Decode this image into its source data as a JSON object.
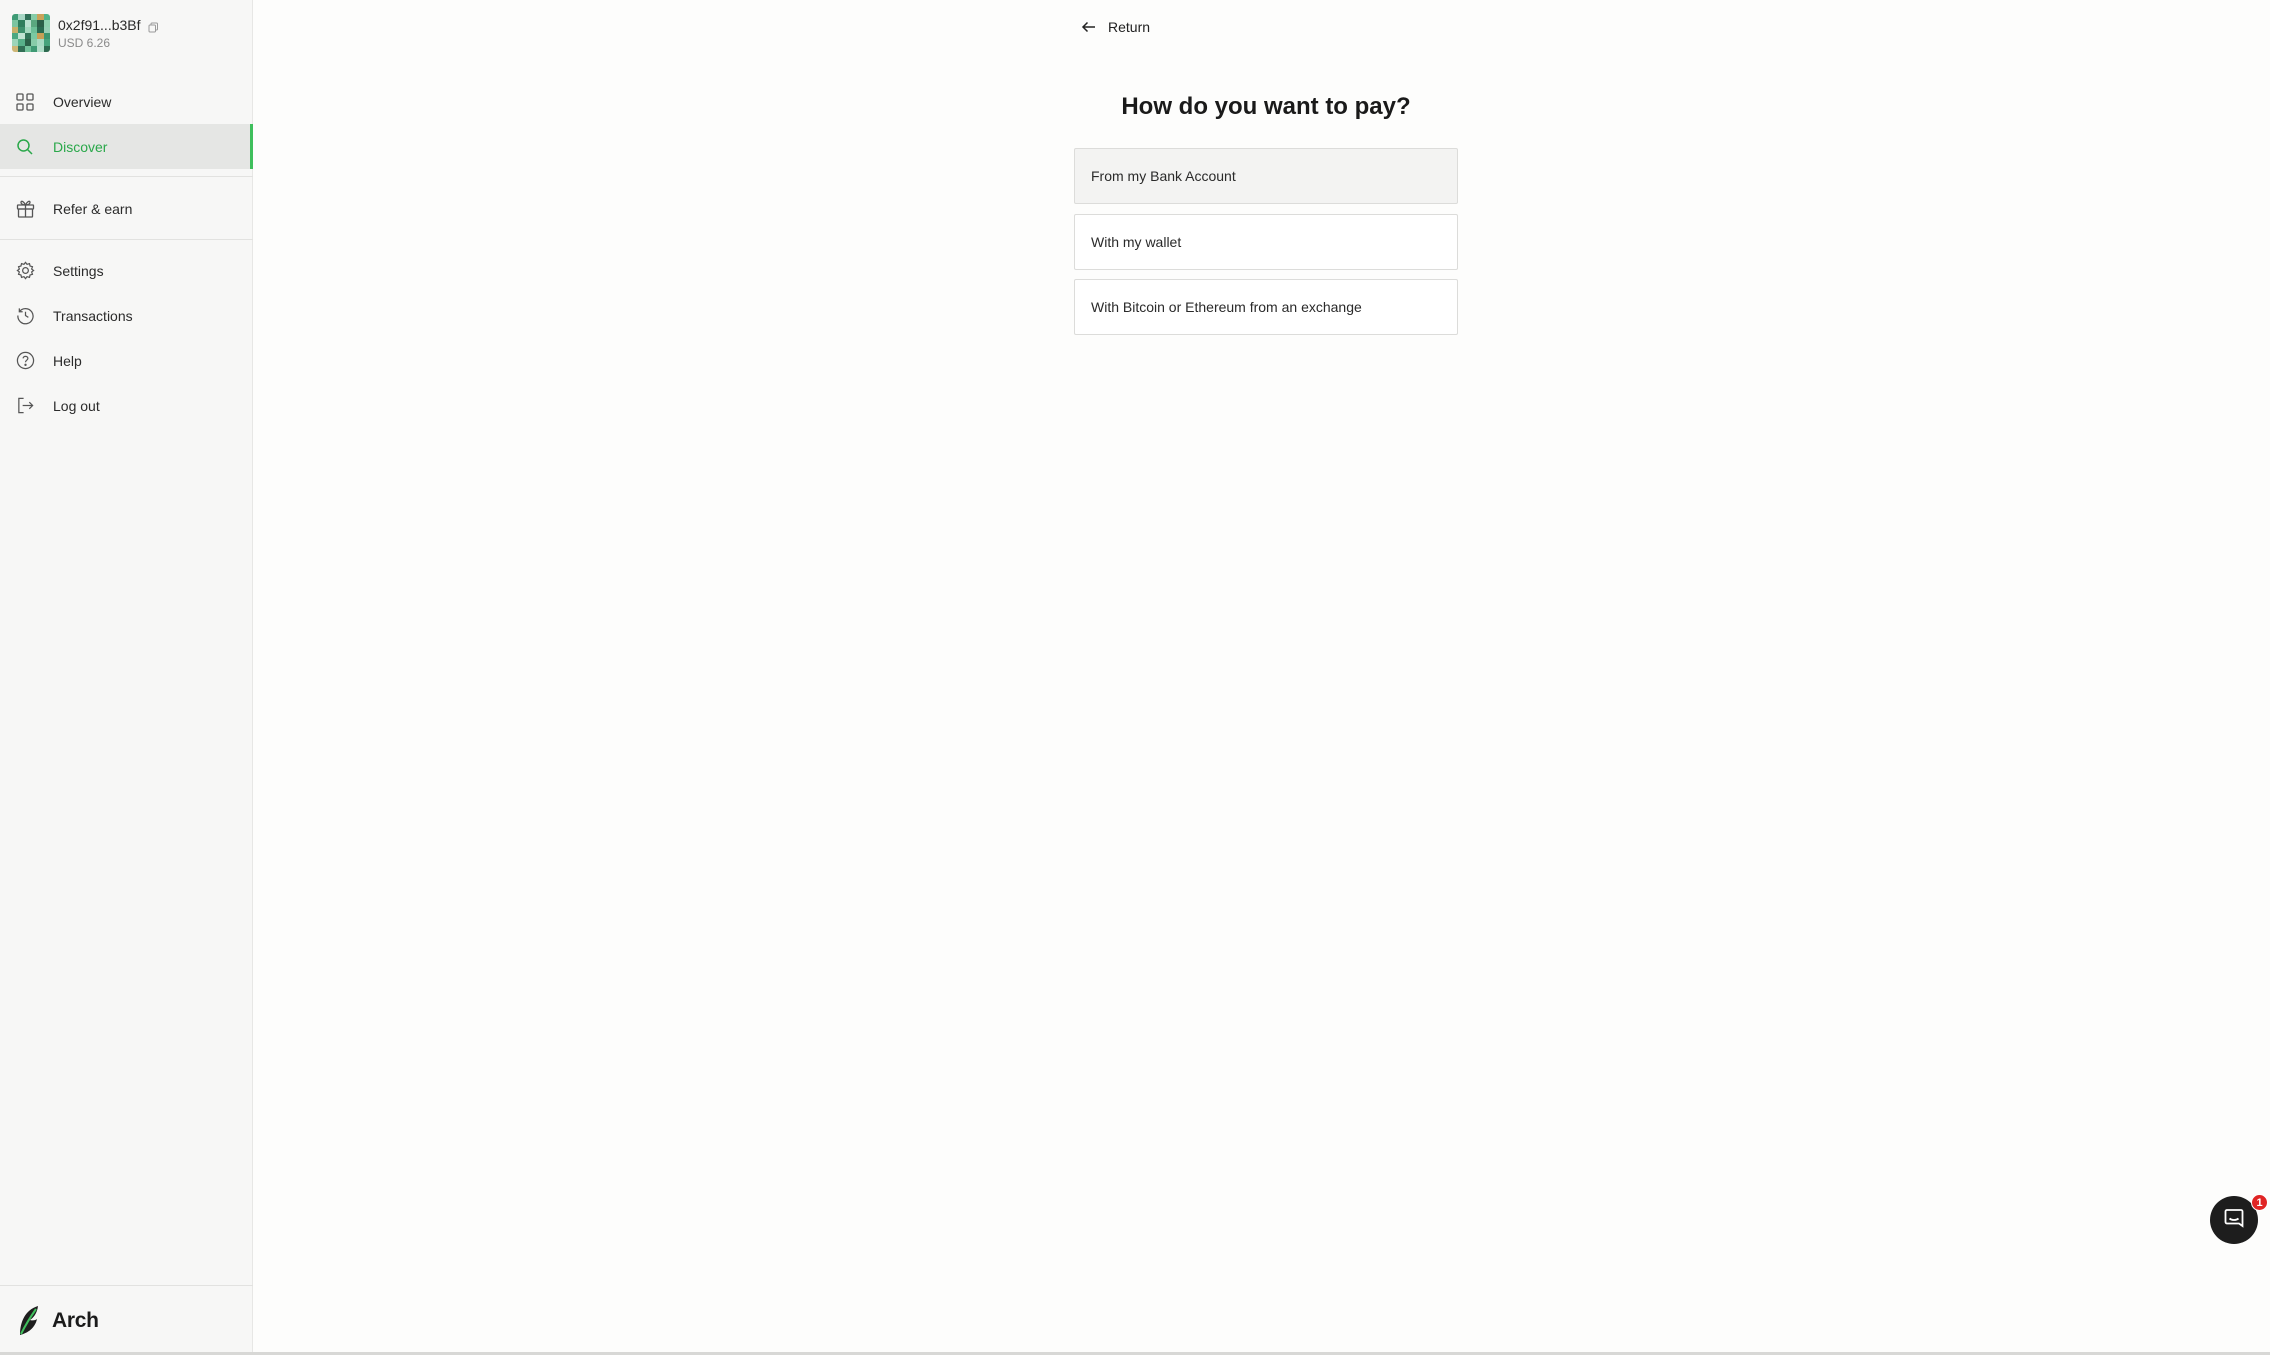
{
  "account": {
    "address": "0x2f91...b3Bf",
    "balance": "USD 6.26",
    "avatar_colors": [
      "#3e9b75",
      "#a6d6c4",
      "#2f6f57",
      "#86cda8",
      "#c9a35a",
      "#4fb38a",
      "#7cc4a0",
      "#2e7d5c",
      "#b8e0cf",
      "#5aa77f",
      "#2c5e49",
      "#8fd1b0",
      "#c6b06a",
      "#3c8f6c",
      "#a2d8be",
      "#6cbf97",
      "#2a6a50",
      "#96cfb5",
      "#4aa882",
      "#bfe3d2",
      "#2f7357",
      "#7ac9a2",
      "#c79f57",
      "#3b9670",
      "#9dd4b9",
      "#58b089",
      "#2b6148",
      "#88cca9",
      "#a8dac3",
      "#47a37c",
      "#cdb675",
      "#316f55",
      "#73c29b",
      "#3f9a74",
      "#b0ddc8",
      "#2d6a4f"
    ]
  },
  "nav": {
    "overview": "Overview",
    "discover": "Discover",
    "refer": "Refer & earn",
    "settings": "Settings",
    "transactions": "Transactions",
    "help": "Help",
    "logout": "Log out"
  },
  "brand": {
    "name": "Arch"
  },
  "main": {
    "return_label": "Return",
    "title": "How do you want to pay?",
    "options": [
      {
        "label": "From my Bank Account"
      },
      {
        "label": "With my wallet"
      },
      {
        "label": "With Bitcoin or Ethereum from an exchange"
      }
    ]
  },
  "chat": {
    "badge_count": "1"
  },
  "colors": {
    "accent": "#3fbf5c",
    "active_text": "#2aa84a",
    "badge": "#e02424"
  }
}
